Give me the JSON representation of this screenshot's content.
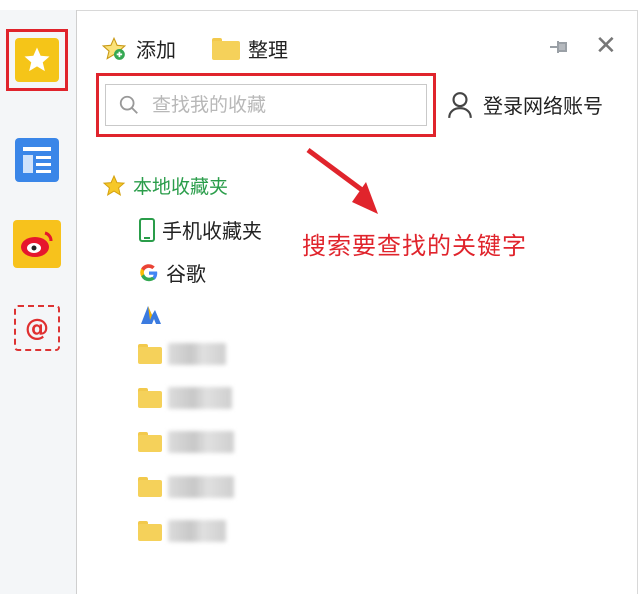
{
  "toolbar": {
    "add_label": "添加",
    "organize_label": "整理"
  },
  "search": {
    "placeholder": "查找我的收藏"
  },
  "account": {
    "login_label": "登录网络账号"
  },
  "tree": {
    "root_label": "本地收藏夹",
    "items": [
      {
        "label": "手机收藏夹",
        "icon": "phone-icon"
      },
      {
        "label": "谷歌",
        "icon": "google-icon"
      },
      {
        "label": "",
        "icon": "bookmark-logo-icon"
      }
    ],
    "blurred_folders": 5
  },
  "annotation": {
    "text": "搜索要查找的关键字"
  },
  "sidebar": {
    "items": [
      "favorites",
      "news",
      "weibo",
      "mail"
    ]
  },
  "colors": {
    "highlight": "#e0242c",
    "root_green": "#2a9d4a",
    "favorite_yellow": "#f5c518"
  }
}
